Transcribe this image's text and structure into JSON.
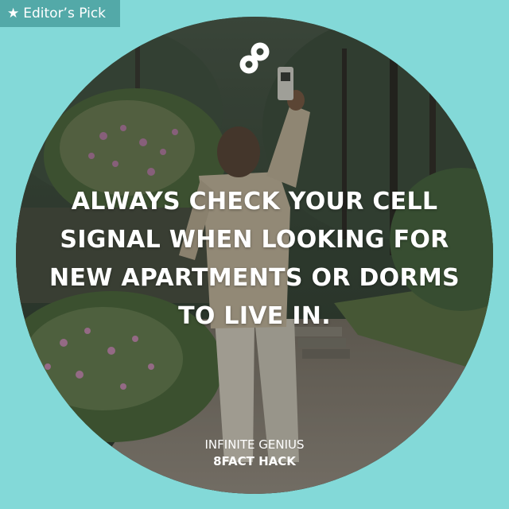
{
  "badge": {
    "icon": "star-icon",
    "label": "Editor’s Pick"
  },
  "logo": {
    "icon": "infinity-eight-logo-icon"
  },
  "headline": {
    "lines": [
      "ALWAYS CHECK YOUR CELL",
      "SIGNAL WHEN LOOKING FOR",
      "NEW APARTMENTS OR DORMS",
      "TO LIVE IN."
    ]
  },
  "footer": {
    "line1": "INFINITE GENIUS",
    "line2": "8FACT HACK"
  },
  "colors": {
    "background": "#83d9d8",
    "badge": "#53a9a8",
    "text": "#ffffff"
  }
}
